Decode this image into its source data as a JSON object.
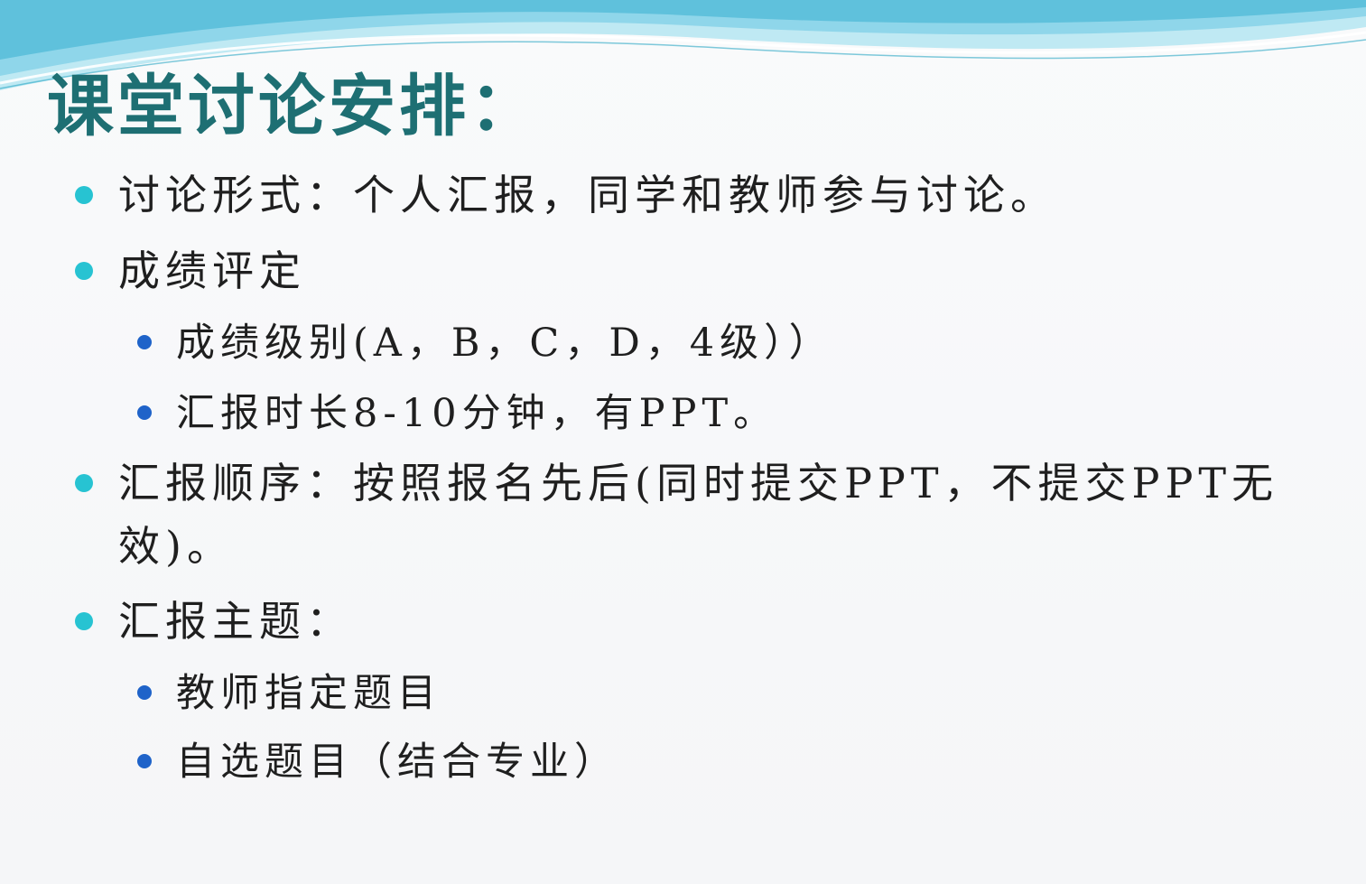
{
  "slide": {
    "title": "课堂讨论安排：",
    "items": [
      {
        "level": 1,
        "text": "讨论形式：个人汇报，同学和教师参与讨论。"
      },
      {
        "level": 1,
        "text": "成绩评定"
      },
      {
        "level": 2,
        "text": "成绩级别(A，B，C，D，4级））"
      },
      {
        "level": 2,
        "text": "汇报时长8-10分钟，有PPT。"
      },
      {
        "level": 1,
        "text": "汇报顺序：按照报名先后(同时提交PPT，不提交PPT无效)。"
      },
      {
        "level": 1,
        "text": "汇报主题："
      },
      {
        "level": 2,
        "text": "教师指定题目"
      },
      {
        "level": 2,
        "text": "自选题目（结合专业）"
      }
    ]
  },
  "colors": {
    "title": "#1e6f73",
    "bullet_level1": "#27c3d2",
    "bullet_level2": "#1f63c9",
    "text": "#1f1f1f",
    "wave_light": "#bfe9f3",
    "wave_dark": "#5fc1dc"
  }
}
